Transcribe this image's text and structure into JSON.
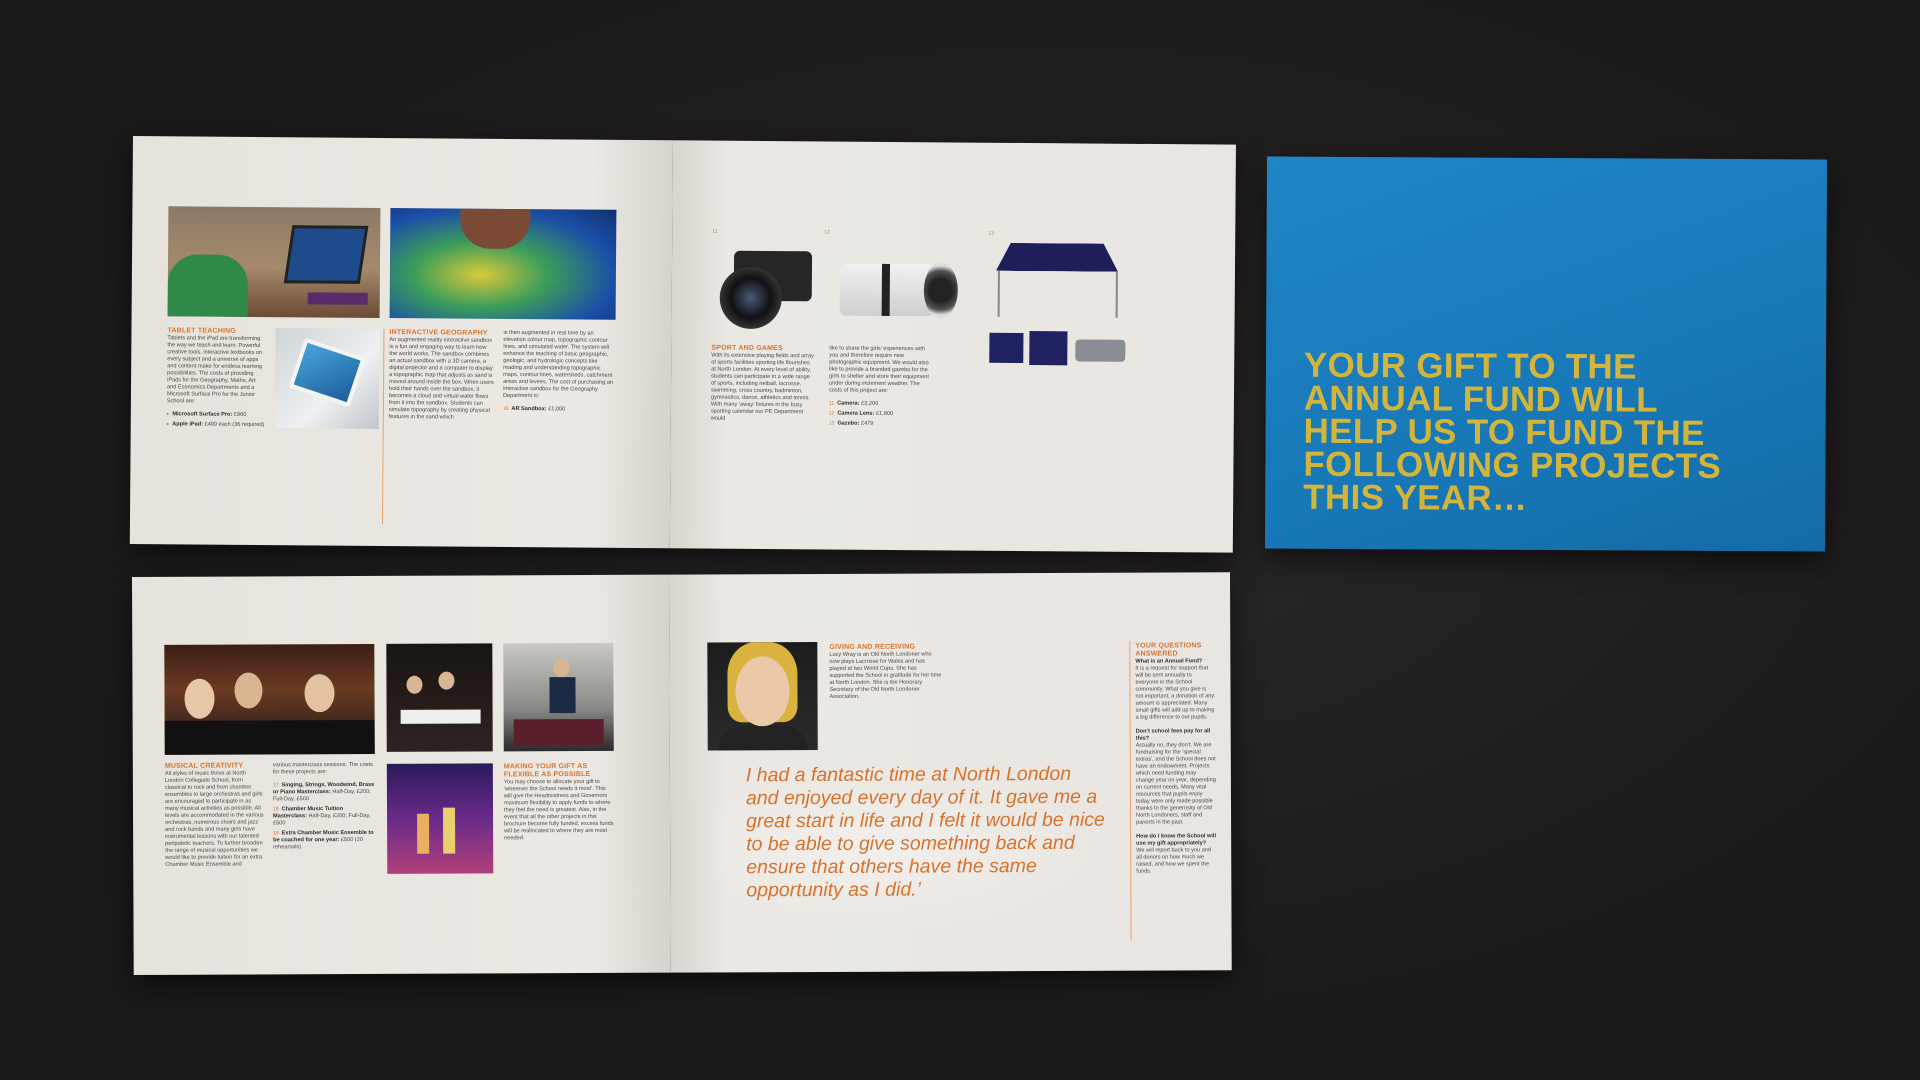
{
  "cover": {
    "lines": [
      "YOUR GIFT TO THE",
      "ANNUAL FUND WILL",
      "HELP US TO FUND THE",
      "FOLLOWING PROJECTS",
      "THIS YEAR…"
    ],
    "color": "#d2b53a",
    "background": "#1b7fc0"
  },
  "top_spread": {
    "tablet": {
      "heading": "TABLET TEACHING",
      "body": "Tablets and the iPad are transforming the way we teach and learn. Powerful creative tools, interactive textbooks on every subject and a universe of apps and content make for endless learning possibilities. The costs of providing iPads for the Geography, Maths, Art and Economics Departments and a Microsoft Surface Pro for the Junior School are:",
      "items": [
        {
          "label": "Microsoft Surface Pro:",
          "value": "£960"
        },
        {
          "label": "Apple iPad:",
          "value": "£400 each (36 required)"
        }
      ]
    },
    "geography": {
      "heading": "INTERACTIVE GEOGRAPHY",
      "body": "An augmented reality interactive sandbox is a fun and engaging way to learn how the world works. The sandbox combines an actual sandbox with a 3D camera, a digital projector and a computer to display a topographic map that adjusts as sand is moved around inside the box. When users hold their hands over the sandbox, it becomes a cloud and virtual water flows from it into the sandbox. Students can simulate topography by creating physical features in the sand which",
      "body2": "is then augmented in real time by an elevation colour map, topographic contour lines, and simulated water. The system will enhance the teaching of basic geographic, geologic, and hydrologic concepts like reading and understanding topographic maps, contour lines, watersheds, catchment areas and levees. The cost of purchasing an interactive sandbox for the Geography Department is:",
      "item_num": "16",
      "item_label": "AR Sandbox:",
      "item_value": "£1,000"
    },
    "sport": {
      "photo_nums": [
        "11",
        "12",
        "13"
      ],
      "heading": "SPORT AND GAMES",
      "body": "With its extensive playing fields and array of sports facilities sporting life flourishes at North London. At every level of ability, students can participate in a wide range of sports, including netball, lacrosse, swimming, cross country, badminton, gymnastics, dance, athletics and tennis. With many ‘away’ fixtures in the busy sporting calendar our PE Department would",
      "body2": "like to share the girls’ experiences with you and therefore require new photographic equipment. We would also like to provide a branded gazebo for the girls to shelter and store their equipment under during inclement weather. The costs of this project are:",
      "items": [
        {
          "num": "11",
          "label": "Camera:",
          "value": "£3,200"
        },
        {
          "num": "12",
          "label": "Camera Lens:",
          "value": "£1,800"
        },
        {
          "num": "13",
          "label": "Gazebo:",
          "value": "£479"
        }
      ]
    }
  },
  "bottom_spread": {
    "music": {
      "heading": "MUSICAL CREATIVITY",
      "body": "All styles of music thrive at North London Collegiate School, from classical to rock and from chamber ensembles to large orchestras and girls are encouraged to participate in as many musical activities as possible. All levels are accommodated in the various orchestras, numerous choirs and jazz and rock bands and many girls have instrumental lessons with our talented peripatetic teachers. To further broaden the range of musical opportunities we would like to provide tuition for an extra Chamber Music Ensemble and",
      "body2": "various masterclass sessions. The costs for these projects are:",
      "items": [
        {
          "num": "17",
          "label": "Singing, Strings, Woodwind, Brass or Piano Masterclass:",
          "value": "Half-Day, £200; Full-Day, £500"
        },
        {
          "num": "18",
          "label": "Chamber Music Tuition Masterclass:",
          "value": "Half-Day, £200; Full-Day, £500"
        },
        {
          "num": "19",
          "label": "Extra Chamber Music Ensemble to be coached for one year:",
          "value": "£500 (20 rehearsals)"
        }
      ]
    },
    "flexible": {
      "heading": "MAKING YOUR GIFT AS FLEXIBLE AS POSSIBLE",
      "body": "You may choose to allocate your gift to ‘wherever the School needs it most’. This will give the Headmistress and Governors maximum flexibility to apply funds to where they feel the need is greatest. Also, in the event that all the other projects in this brochure become fully funded, excess funds will be reallocated to where they are most needed."
    },
    "giving": {
      "heading": "GIVING AND RECEIVING",
      "body": "Lucy Wray is an Old North Londoner who now plays Lacrosse for Wales and has played at two World Cups. She has supported the School in gratitude for her time at North London. She is the Honorary Secretary of the Old North Londoner Association."
    },
    "quote": "I had a fantastic time at North London and enjoyed every day of it. It gave me a great start in life and I felt it would be nice to be able to give something back and ensure that others have the same opportunity as I did.’",
    "questions": {
      "heading": "YOUR QUESTIONS ANSWERED",
      "qa": [
        {
          "q": "What is an Annual Fund?",
          "a": "It is a request for support that will be sent annually to everyone in the School community. What you give is not important; a donation of any amount is appreciated. Many small gifts will add up to making a big difference to our pupils."
        },
        {
          "q": "Don’t school fees pay for all this?",
          "a": "Actually no, they don’t. We are fundraising for the ‘special extras’, and the School does not have an endowment. Projects which need funding may change year on year, depending on current needs. Many vital resources that pupils enjoy today were only made possible thanks to the generosity of Old North Londoners, staff and parents in the past."
        },
        {
          "q": "How do I know the School will use my gift appropriately?",
          "a": "We will report back to you and all donors on how much we raised, and how we spent the funds."
        }
      ]
    }
  },
  "colors": {
    "accent": "#d8722d",
    "paper": "#e9e6e1",
    "cover_blue": "#1b7fc0",
    "cover_text": "#d2b53a"
  }
}
